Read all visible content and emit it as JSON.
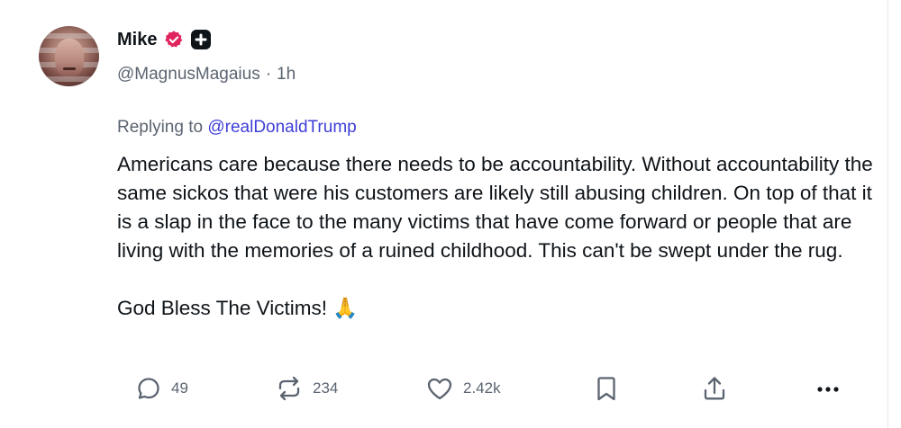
{
  "author": {
    "name": "Mike",
    "handle": "@MagnusMagaius",
    "time": "1h",
    "avatar_icon": "profile-photo",
    "badges": [
      "verified-badge-icon",
      "plus-badge-icon"
    ],
    "verified_color": "#e0245e"
  },
  "reply": {
    "prefix": "Replying to",
    "mention": "@realDonaldTrump"
  },
  "body": {
    "paragraph1": "Americans care because there needs to be accountability. Without accountability the same sickos that were his customers are likely still abusing children. On top of that it is a slap in the face to the many victims that have come forward or people that are living with the memories of a ruined childhood. This can't be swept under the rug.",
    "paragraph2": "God Bless The Victims! 🙏"
  },
  "actions": {
    "reply_count": "49",
    "repost_count": "234",
    "like_count": "2.42k",
    "icons": [
      "reply-icon",
      "repost-icon",
      "like-icon",
      "bookmark-icon",
      "share-icon",
      "more-icon"
    ]
  },
  "colors": {
    "text": "#0f1419",
    "muted": "#5b6470",
    "mention": "#3f3fd8"
  }
}
